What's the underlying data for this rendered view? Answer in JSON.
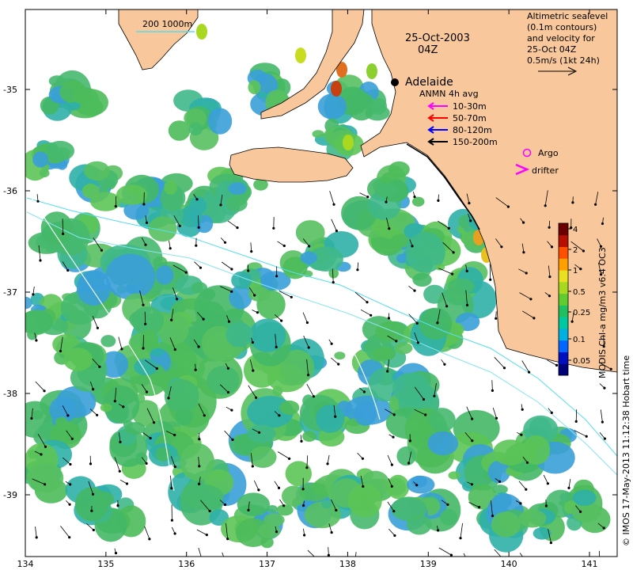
{
  "title": {
    "date": "25-Oct-2003",
    "time": "04Z"
  },
  "city": {
    "name": "Adelaide"
  },
  "scale_bar": {
    "label": "200  1000m"
  },
  "altimetry_note": {
    "lines": [
      "Altimetric sealevel",
      "(0.1m contours)",
      "and velocity for",
      "25-Oct 04Z",
      "0.5m/s (1kt 24h)"
    ]
  },
  "anmn_legend": {
    "title": "ANMN 4h avg",
    "entries": [
      {
        "label": "10-30m",
        "color": "#ff00ff"
      },
      {
        "label": "50-70m",
        "color": "#ff0000"
      },
      {
        "label": "80-120m",
        "color": "#0000ff"
      },
      {
        "label": "150-200m",
        "color": "#000000"
      }
    ]
  },
  "markers": {
    "argo": {
      "label": "Argo",
      "color": "#ff00ff"
    },
    "drifter": {
      "label": "drifter",
      "color": "#ff00ff"
    }
  },
  "colorbar": {
    "title": "MODIS Chl-a mg/m3 v6.4 OC3",
    "ticks": [
      "4",
      "2",
      "1",
      "0.5",
      "0.25",
      "0.1",
      "0.05"
    ],
    "colors": [
      "#00007a",
      "#0010c0",
      "#0066ff",
      "#00b0e0",
      "#00c8a0",
      "#20c060",
      "#60cc30",
      "#a8d820",
      "#e8e020",
      "#ffa000",
      "#ff5000",
      "#b81000",
      "#6a0000"
    ]
  },
  "x_axis": {
    "ticks": [
      "134",
      "135",
      "136",
      "137",
      "138",
      "139",
      "140",
      "141"
    ]
  },
  "y_axis": {
    "ticks": [
      "-35",
      "-36",
      "-37",
      "-38",
      "-39"
    ]
  },
  "credit": "© IMOS 17-May-2013 11:12:38 Hobart time",
  "colors": {
    "land": "#f8c89c",
    "ocean": "#ffffff",
    "chl_green": "#44bb55",
    "chl_cyan": "#33bbaa",
    "chl_blue": "#3399dd",
    "contour": "#55ddee"
  }
}
